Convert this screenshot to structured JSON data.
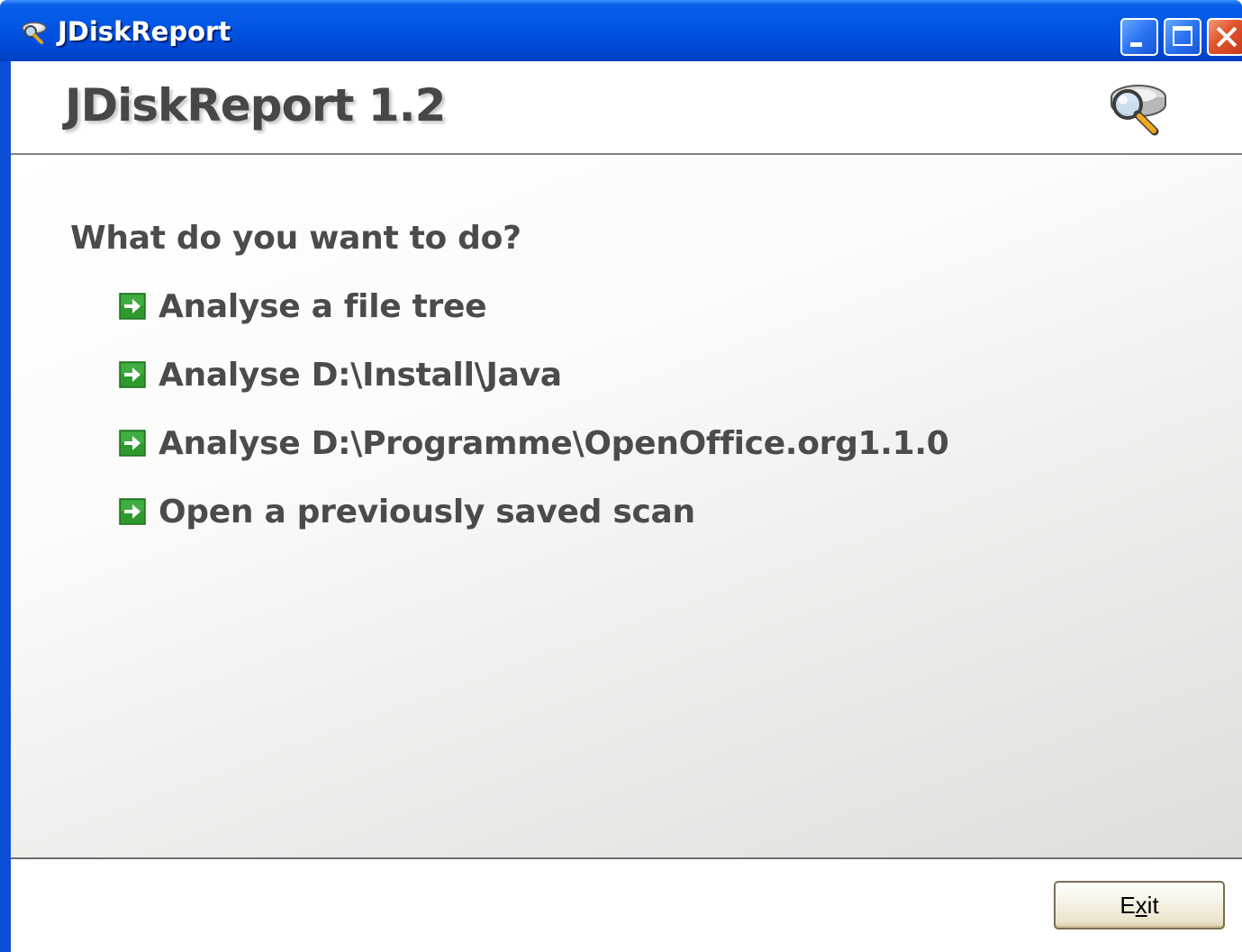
{
  "window": {
    "title": "JDiskReport",
    "controls": {
      "minimize": "minimize",
      "maximize": "maximize",
      "close": "close"
    }
  },
  "header": {
    "app_title": "JDiskReport 1.2",
    "icon": "disk-magnifier-icon"
  },
  "main": {
    "question": "What do you want to do?",
    "actions": [
      {
        "label": "Analyse a file tree",
        "icon": "green-arrow-icon"
      },
      {
        "label": "Analyse D:\\Install\\Java",
        "icon": "green-arrow-icon"
      },
      {
        "label": "Analyse D:\\Programme\\OpenOffice.org1.1.0",
        "icon": "green-arrow-icon"
      },
      {
        "label": "Open a previously saved scan",
        "icon": "green-arrow-icon"
      }
    ]
  },
  "footer": {
    "exit_label": "Exit",
    "exit_mnemonic": "x"
  },
  "colors": {
    "title_bar": "#0055e5",
    "text": "#4b4b4b",
    "arrow_green": "#2e9a2e"
  }
}
